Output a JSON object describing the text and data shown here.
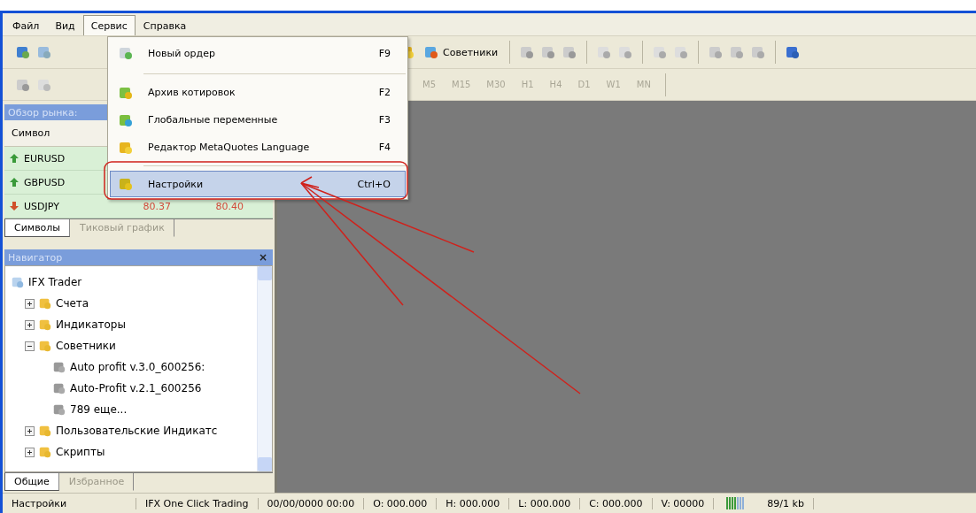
{
  "menu_bar": [
    {
      "label": "Файл",
      "selected": false
    },
    {
      "label": "Вид",
      "selected": false
    },
    {
      "label": "Сервис",
      "selected": true
    },
    {
      "label": "Справка",
      "selected": false
    }
  ],
  "dropdown": [
    {
      "label": "Новый ордер",
      "shortcut": "F9",
      "selected": false
    },
    {
      "label": "Архив котировок",
      "shortcut": "F2",
      "selected": false
    },
    {
      "label": "Глобальные переменные",
      "shortcut": "F3",
      "selected": false
    },
    {
      "label": "Редактор MetaQuotes Language",
      "shortcut": "F4",
      "selected": false
    },
    {
      "label": "Настройки",
      "shortcut": "Ctrl+O",
      "selected": true
    }
  ],
  "toolbar": {
    "experts_button": "Советники",
    "timeframes": [
      "M5",
      "M15",
      "M30",
      "H1",
      "H4",
      "D1",
      "W1",
      "MN"
    ]
  },
  "market_watch": {
    "title": "Обзор рынка:",
    "column_1": "Символ",
    "rows": [
      {
        "symbol": "EURUSD",
        "rising": true
      },
      {
        "symbol": "GBPUSD",
        "rising": true
      },
      {
        "symbol": "USDJPY",
        "rising": false,
        "bid": "80.37",
        "ask": "80.40"
      }
    ],
    "tabs": [
      {
        "label": "Символы",
        "selected": true
      },
      {
        "label": "Тиковый график",
        "selected": false
      }
    ]
  },
  "navigator": {
    "title": "Навигатор",
    "close": "×",
    "tree": [
      {
        "label": "IFX Trader",
        "children": [
          {
            "label": "Счета",
            "expanded": false
          },
          {
            "label": "Индикаторы",
            "expanded": false
          },
          {
            "label": "Советники",
            "expanded": true,
            "children": [
              {
                "label": "Auto profit v.3.0_600256:"
              },
              {
                "label": "Auto-Profit v.2.1_600256"
              },
              {
                "label": "789 еще..."
              }
            ]
          },
          {
            "label": "Пользовательские Индикатс",
            "expanded": false
          },
          {
            "label": "Скрипты",
            "expanded": false
          }
        ]
      }
    ],
    "tabs": [
      {
        "label": "Общие",
        "selected": true
      },
      {
        "label": "Избранное",
        "selected": false
      }
    ]
  },
  "status_bar": [
    "Настройки",
    "IFX One Click Trading",
    "00/00/0000 00:00",
    "O: 000.000",
    "H: 000.000",
    "L: 000.000",
    "C: 000.000",
    "V: 00000",
    "89/1 kb"
  ]
}
